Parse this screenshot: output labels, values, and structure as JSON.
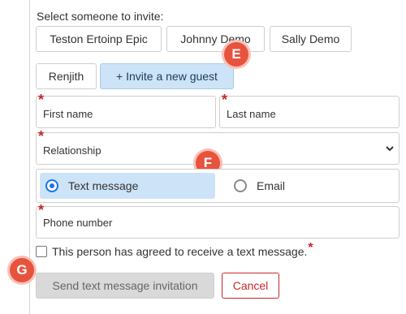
{
  "prompt": "Select someone to invite:",
  "people": [
    "Teston Ertoinp Epic",
    "Johnny Demo",
    "Sally Demo",
    "Renjith"
  ],
  "invite_new": "+ Invite a new guest",
  "fields": {
    "first_name": "First name",
    "last_name": "Last name",
    "relationship": "Relationship",
    "phone": "Phone number"
  },
  "contact_method": {
    "options": [
      "Text message",
      "Email"
    ],
    "selected": "Text message"
  },
  "agree_text": "This person has agreed to receive a text message.",
  "required_mark": "*",
  "buttons": {
    "send": "Send text message invitation",
    "cancel": "Cancel"
  },
  "markers": [
    "E",
    "F",
    "G"
  ],
  "colors": {
    "accent_blue": "#1a73e8",
    "selected_bg": "#cde3f7",
    "required_red": "#c62828",
    "marker_orange": "#e8533d"
  }
}
